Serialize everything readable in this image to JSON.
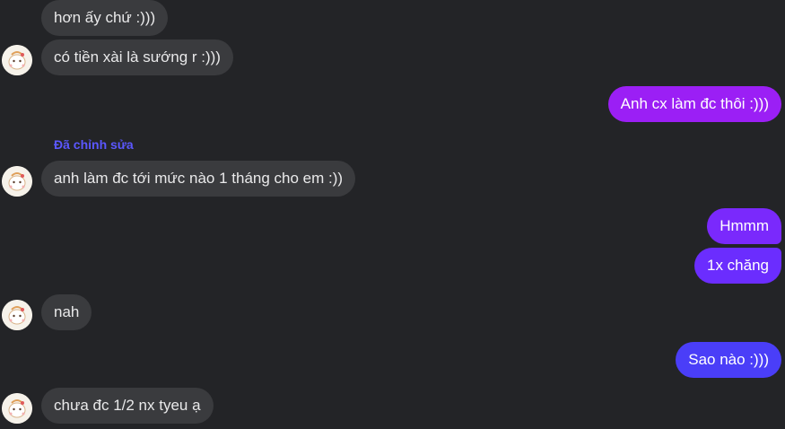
{
  "messages": {
    "m1": "hơn ấy chứ :)))",
    "m2": "có tiền xài là sướng r :)))",
    "m3": "Anh cx làm đc thôi :)))",
    "m4": "anh làm đc tới mức nào 1 tháng cho em :))",
    "m5": "Hmmm",
    "m6": "1x chăng",
    "m7": "nah",
    "m8": "Sao nào :)))",
    "m9": "chưa đc 1/2 nx tyeu ạ"
  },
  "edited_label": "Đã chỉnh sửa",
  "colors": {
    "background": "#232427",
    "received_bubble": "#3a3b3e",
    "sent_top": "#9b1ff5",
    "sent_mid": "#6e2bff",
    "sent_bottom": "#4a3ef8",
    "edited_label": "#5b57ff"
  },
  "icons": {
    "avatar": "contact-avatar-icon"
  }
}
